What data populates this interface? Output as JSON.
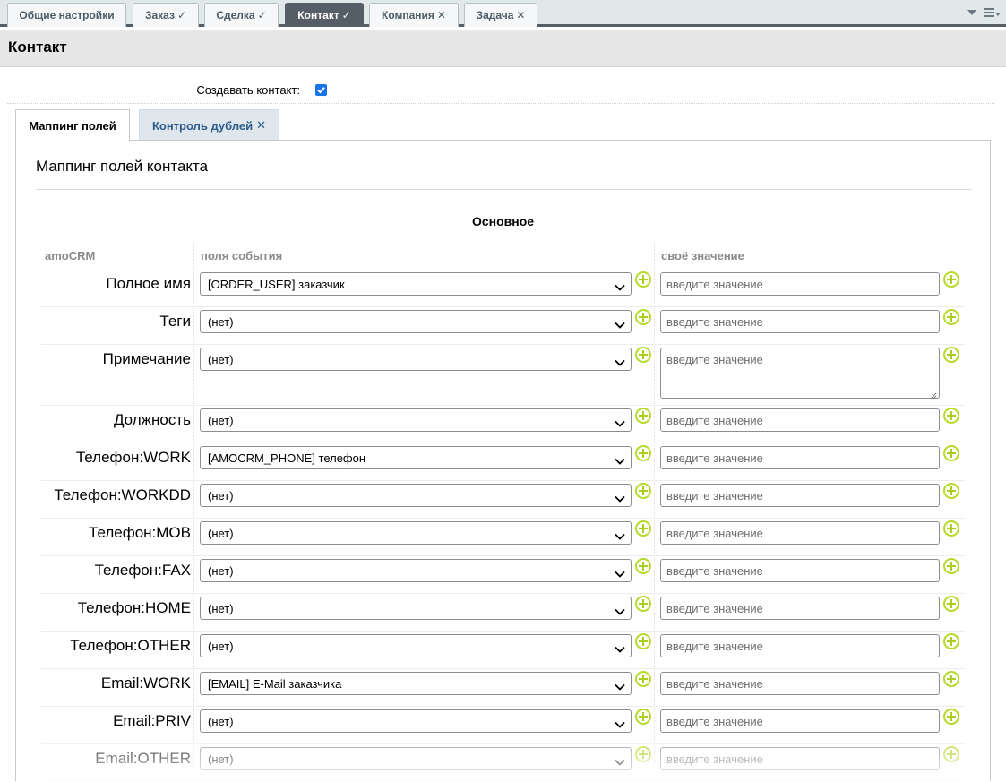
{
  "top_tabs": [
    {
      "label": "Общие настройки",
      "mark": ""
    },
    {
      "label": "Заказ",
      "mark": "✓"
    },
    {
      "label": "Сделка",
      "mark": "✓"
    },
    {
      "label": "Контакт",
      "mark": "✓"
    },
    {
      "label": "Компания",
      "mark": "✕"
    },
    {
      "label": "Задача",
      "mark": "✕"
    }
  ],
  "header": {
    "title": "Контакт"
  },
  "create_contact": {
    "label": "Создавать контакт:",
    "checked": true
  },
  "inner_tabs": [
    {
      "label": "Маппинг полей"
    },
    {
      "label": "Контроль дублей",
      "mark": "✕"
    }
  ],
  "section": {
    "title": "Маппинг полей контакта",
    "group": "Основное"
  },
  "columns": {
    "amocrm": "amoCRM",
    "event_fields": "поля события",
    "own_value": "своё значение"
  },
  "rows": [
    {
      "name": "Полное имя",
      "select": "[ORDER_USER] заказчик",
      "placeholder": "введите значение"
    },
    {
      "name": "Теги",
      "select": "(нет)",
      "placeholder": "введите значение"
    },
    {
      "name": "Примечание",
      "select": "(нет)",
      "placeholder": "введите значение"
    },
    {
      "name": "Должность",
      "select": "(нет)",
      "placeholder": "введите значение"
    },
    {
      "name": "Телефон:WORK",
      "select": "[AMOCRM_PHONE] телефон",
      "placeholder": "введите значение"
    },
    {
      "name": "Телефон:WORKDD",
      "select": "(нет)",
      "placeholder": "введите значение"
    },
    {
      "name": "Телефон:MOB",
      "select": "(нет)",
      "placeholder": "введите значение"
    },
    {
      "name": "Телефон:FAX",
      "select": "(нет)",
      "placeholder": "введите значение"
    },
    {
      "name": "Телефон:HOME",
      "select": "(нет)",
      "placeholder": "введите значение"
    },
    {
      "name": "Телефон:OTHER",
      "select": "(нет)",
      "placeholder": "введите значение"
    },
    {
      "name": "Email:WORK",
      "select": "[EMAIL] E-Mail заказчика",
      "placeholder": "введите значение"
    },
    {
      "name": "Email:PRIV",
      "select": "(нет)",
      "placeholder": "введите значение"
    },
    {
      "name": "Email:OTHER",
      "select": "(нет)",
      "placeholder": "введите значение"
    }
  ],
  "colors": {
    "accent": "#555d66",
    "add_button": "#b6da2a",
    "tab_inactive_text": "#2b5c8a"
  }
}
